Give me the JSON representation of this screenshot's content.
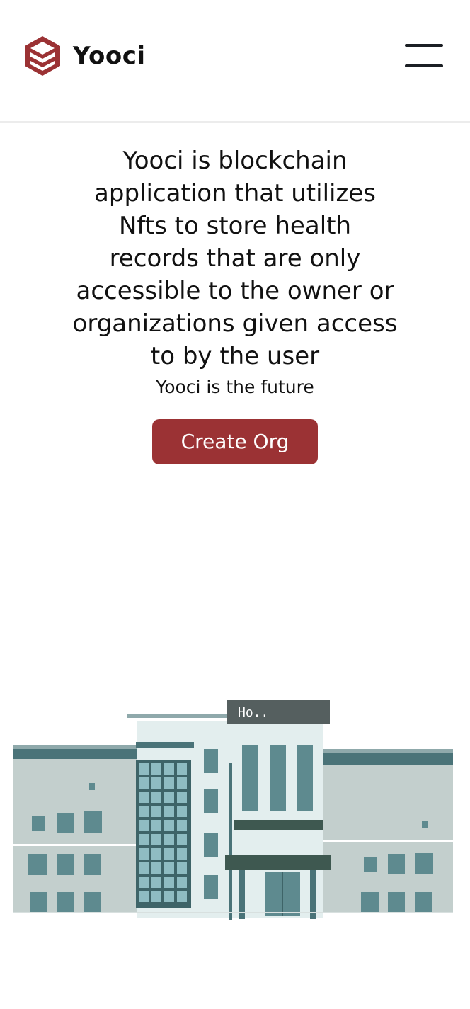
{
  "header": {
    "brand": "Yooci",
    "logo_icon": "stacked-cube-logo-icon",
    "menu_icon": "hamburger-menu-icon"
  },
  "hero": {
    "headline": "Yooci is blockchain application that utilizes Nfts to store health records that are only accessible to the owner or organizations given access to by the user",
    "subtitle": "Yooci is the future",
    "cta_label": "Create Org"
  },
  "illustration": {
    "sign_text": "Ho..",
    "icon": "hospital-building-illustration"
  },
  "colors": {
    "accent": "#9b3234",
    "text": "#111111",
    "divider": "#ececec",
    "building_dark": "#4a7378",
    "building_light": "#c3cfcd",
    "building_pale": "#e3eeee"
  }
}
